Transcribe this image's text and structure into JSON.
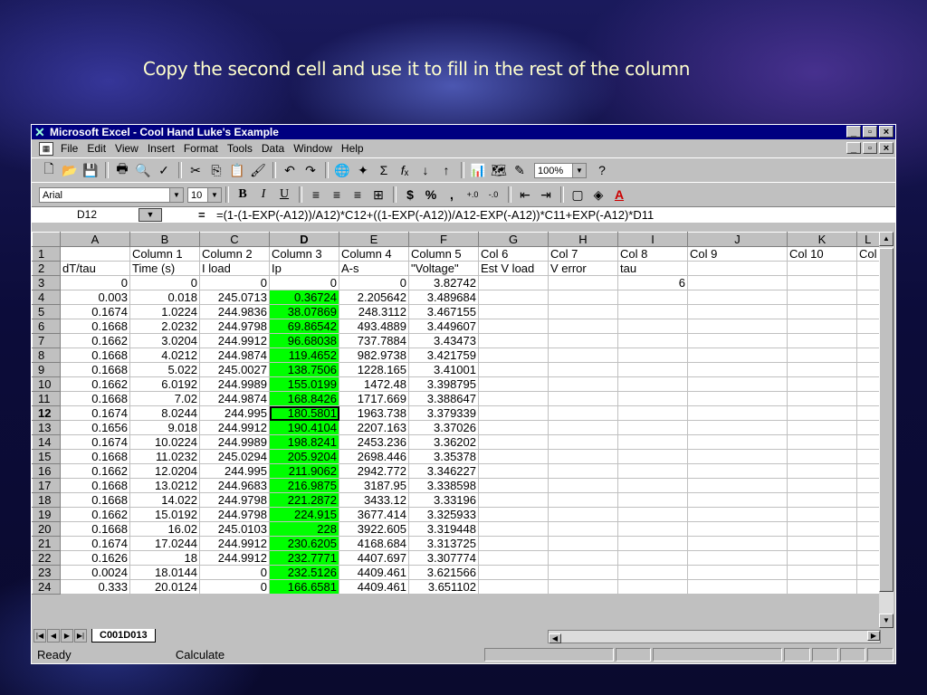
{
  "slide": {
    "title": "Copy the second cell and use it to fill in the rest of the column"
  },
  "window": {
    "title": "Microsoft Excel - Cool Hand Luke's Example",
    "minimize": "_",
    "restore": "×",
    "close": "×"
  },
  "menu": [
    "File",
    "Edit",
    "View",
    "Insert",
    "Format",
    "Tools",
    "Data",
    "Window",
    "Help"
  ],
  "toolbar": {
    "zoom": "100%",
    "font": "Arial",
    "size": "10"
  },
  "formula_bar": {
    "cell": "D12",
    "eq": "=",
    "formula": "=(1-(1-EXP(-A12))/A12)*C12+((1-EXP(-A12))/A12-EXP(-A12))*C11+EXP(-A12)*D11"
  },
  "columns": [
    "A",
    "B",
    "C",
    "D",
    "E",
    "F",
    "G",
    "H",
    "I",
    "J",
    "K",
    "L"
  ],
  "column_header_partial": "Col",
  "rows": [
    [
      "1",
      "",
      "Column 1",
      "Column 2",
      "Column 3",
      "Column 4",
      "Column 5",
      "Col 6",
      "Col 7",
      "Col 8",
      "Col 9",
      "Col 10",
      "Col"
    ],
    [
      "2",
      "dT/tau",
      "Time (s)",
      "I load",
      "Ip",
      "A-s",
      "\"Voltage\"",
      "Est V load",
      "V error",
      "tau",
      "",
      "",
      ""
    ],
    [
      "3",
      "0",
      "0",
      "0",
      "0",
      "0",
      "3.82742",
      "",
      "",
      "6",
      "",
      "",
      ""
    ],
    [
      "4",
      "0.003",
      "0.018",
      "245.0713",
      "0.36724",
      "2.205642",
      "3.489684",
      "",
      "",
      "",
      "",
      "",
      ""
    ],
    [
      "5",
      "0.1674",
      "1.0224",
      "244.9836",
      "38.07869",
      "248.3112",
      "3.467155",
      "",
      "",
      "",
      "",
      "",
      ""
    ],
    [
      "6",
      "0.1668",
      "2.0232",
      "244.9798",
      "69.86542",
      "493.4889",
      "3.449607",
      "",
      "",
      "",
      "",
      "",
      ""
    ],
    [
      "7",
      "0.1662",
      "3.0204",
      "244.9912",
      "96.68038",
      "737.7884",
      "3.43473",
      "",
      "",
      "",
      "",
      "",
      ""
    ],
    [
      "8",
      "0.1668",
      "4.0212",
      "244.9874",
      "119.4652",
      "982.9738",
      "3.421759",
      "",
      "",
      "",
      "",
      "",
      ""
    ],
    [
      "9",
      "0.1668",
      "5.022",
      "245.0027",
      "138.7506",
      "1228.165",
      "3.41001",
      "",
      "",
      "",
      "",
      "",
      ""
    ],
    [
      "10",
      "0.1662",
      "6.0192",
      "244.9989",
      "155.0199",
      "1472.48",
      "3.398795",
      "",
      "",
      "",
      "",
      "",
      ""
    ],
    [
      "11",
      "0.1668",
      "7.02",
      "244.9874",
      "168.8426",
      "1717.669",
      "3.388647",
      "",
      "",
      "",
      "",
      "",
      ""
    ],
    [
      "12",
      "0.1674",
      "8.0244",
      "244.995",
      "180.5801",
      "1963.738",
      "3.379339",
      "",
      "",
      "",
      "",
      "",
      ""
    ],
    [
      "13",
      "0.1656",
      "9.018",
      "244.9912",
      "190.4104",
      "2207.163",
      "3.37026",
      "",
      "",
      "",
      "",
      "",
      ""
    ],
    [
      "14",
      "0.1674",
      "10.0224",
      "244.9989",
      "198.8241",
      "2453.236",
      "3.36202",
      "",
      "",
      "",
      "",
      "",
      ""
    ],
    [
      "15",
      "0.1668",
      "11.0232",
      "245.0294",
      "205.9204",
      "2698.446",
      "3.35378",
      "",
      "",
      "",
      "",
      "",
      ""
    ],
    [
      "16",
      "0.1662",
      "12.0204",
      "244.995",
      "211.9062",
      "2942.772",
      "3.346227",
      "",
      "",
      "",
      "",
      "",
      ""
    ],
    [
      "17",
      "0.1668",
      "13.0212",
      "244.9683",
      "216.9875",
      "3187.95",
      "3.338598",
      "",
      "",
      "",
      "",
      "",
      ""
    ],
    [
      "18",
      "0.1668",
      "14.022",
      "244.9798",
      "221.2872",
      "3433.12",
      "3.33196",
      "",
      "",
      "",
      "",
      "",
      ""
    ],
    [
      "19",
      "0.1662",
      "15.0192",
      "244.9798",
      "224.915",
      "3677.414",
      "3.325933",
      "",
      "",
      "",
      "",
      "",
      ""
    ],
    [
      "20",
      "0.1668",
      "16.02",
      "245.0103",
      "228",
      "3922.605",
      "3.319448",
      "",
      "",
      "",
      "",
      "",
      ""
    ],
    [
      "21",
      "0.1674",
      "17.0244",
      "244.9912",
      "230.6205",
      "4168.684",
      "3.313725",
      "",
      "",
      "",
      "",
      "",
      ""
    ],
    [
      "22",
      "0.1626",
      "18",
      "244.9912",
      "232.7771",
      "4407.697",
      "3.307774",
      "",
      "",
      "",
      "",
      "",
      ""
    ],
    [
      "23",
      "0.0024",
      "18.0144",
      "0",
      "232.5126",
      "4409.461",
      "3.621566",
      "",
      "",
      "",
      "",
      "",
      ""
    ],
    [
      "24",
      "0.333",
      "20.0124",
      "0",
      "166.6581",
      "4409.461",
      "3.651102",
      "",
      "",
      "",
      "",
      "",
      ""
    ]
  ],
  "sheet_tab": "C001D013",
  "status": {
    "ready": "Ready",
    "mode": "Calculate"
  },
  "colors": {
    "highlight": "#00ff00",
    "titlebar": "#000080",
    "slide_title": "#ffffcc"
  }
}
